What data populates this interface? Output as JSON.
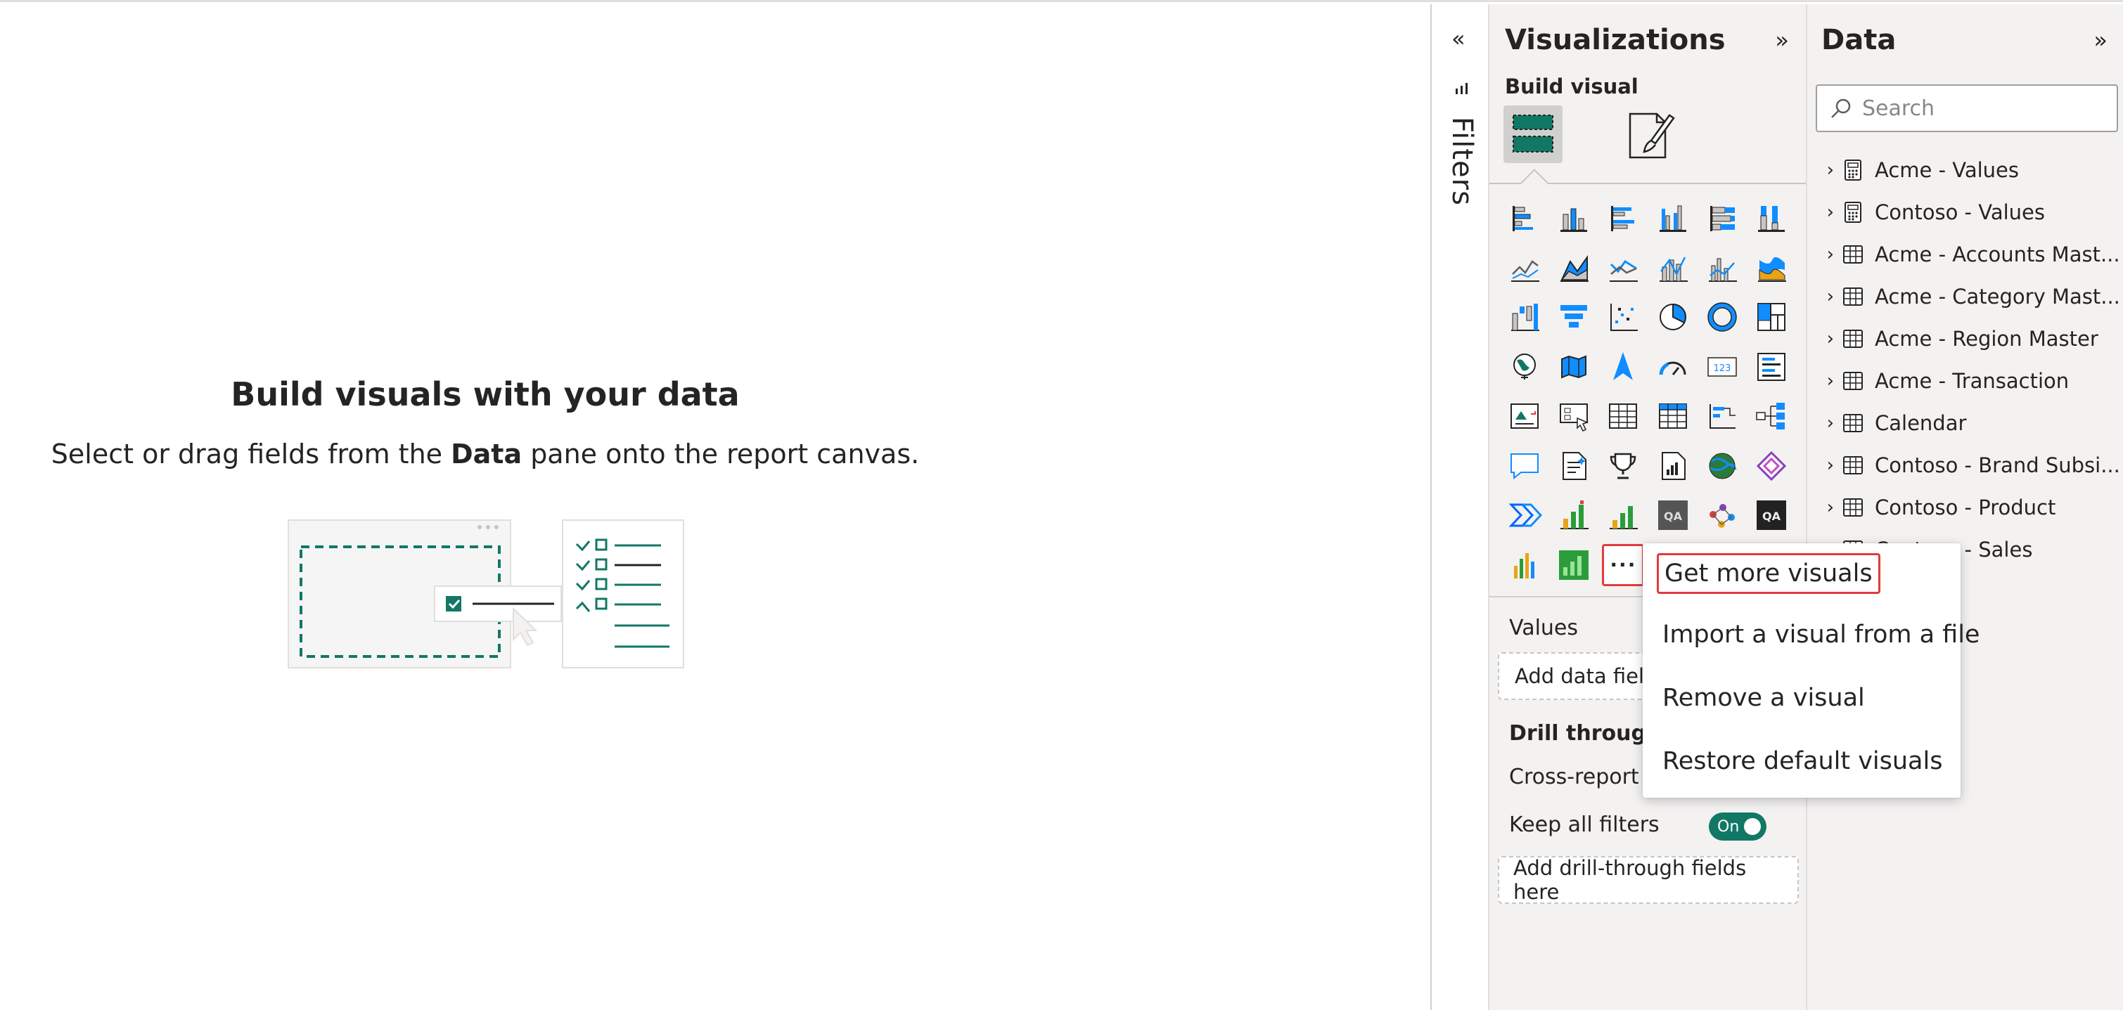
{
  "canvas": {
    "title": "Build visuals with your data",
    "subtitle_pre": "Select or drag fields from the ",
    "subtitle_bold": "Data",
    "subtitle_post": " pane onto the report canvas."
  },
  "filters": {
    "label": "Filters",
    "collapse_icon": "double-chevron-left-icon"
  },
  "visualizations": {
    "title": "Visualizations",
    "build_visual": "Build visual",
    "more_label": "···",
    "values_label": "Values",
    "values_placeholder": "Add data fields here",
    "drill_label": "Drill through",
    "cross_report": "Cross-report",
    "keep_filters": "Keep all filters",
    "toggle_label": "On",
    "drill_placeholder": "Add drill-through fields here"
  },
  "data_pane": {
    "title": "Data",
    "search_placeholder": "Search",
    "tables": [
      {
        "name": "Acme - Values",
        "kind": "calculator-icon"
      },
      {
        "name": "Contoso - Values",
        "kind": "calculator-icon"
      },
      {
        "name": "Acme - Accounts Mast...",
        "kind": "table-icon"
      },
      {
        "name": "Acme - Category Mast...",
        "kind": "table-icon"
      },
      {
        "name": "Acme - Region Master",
        "kind": "table-icon"
      },
      {
        "name": "Acme - Transaction",
        "kind": "table-icon"
      },
      {
        "name": "Calendar",
        "kind": "table-icon"
      },
      {
        "name": "Contoso - Brand Subsi...",
        "kind": "table-icon"
      },
      {
        "name": "Contoso - Product",
        "kind": "table-icon"
      },
      {
        "name": "Contoso - Sales",
        "kind": "table-icon"
      }
    ]
  },
  "context_menu": {
    "items": [
      "Get more visuals",
      "Import a visual from a file",
      "Remove a visual",
      "Restore default visuals"
    ]
  },
  "colors": {
    "accent_teal": "#117865",
    "chart_blue": "#118dff",
    "highlight_red": "#e23b3b"
  }
}
